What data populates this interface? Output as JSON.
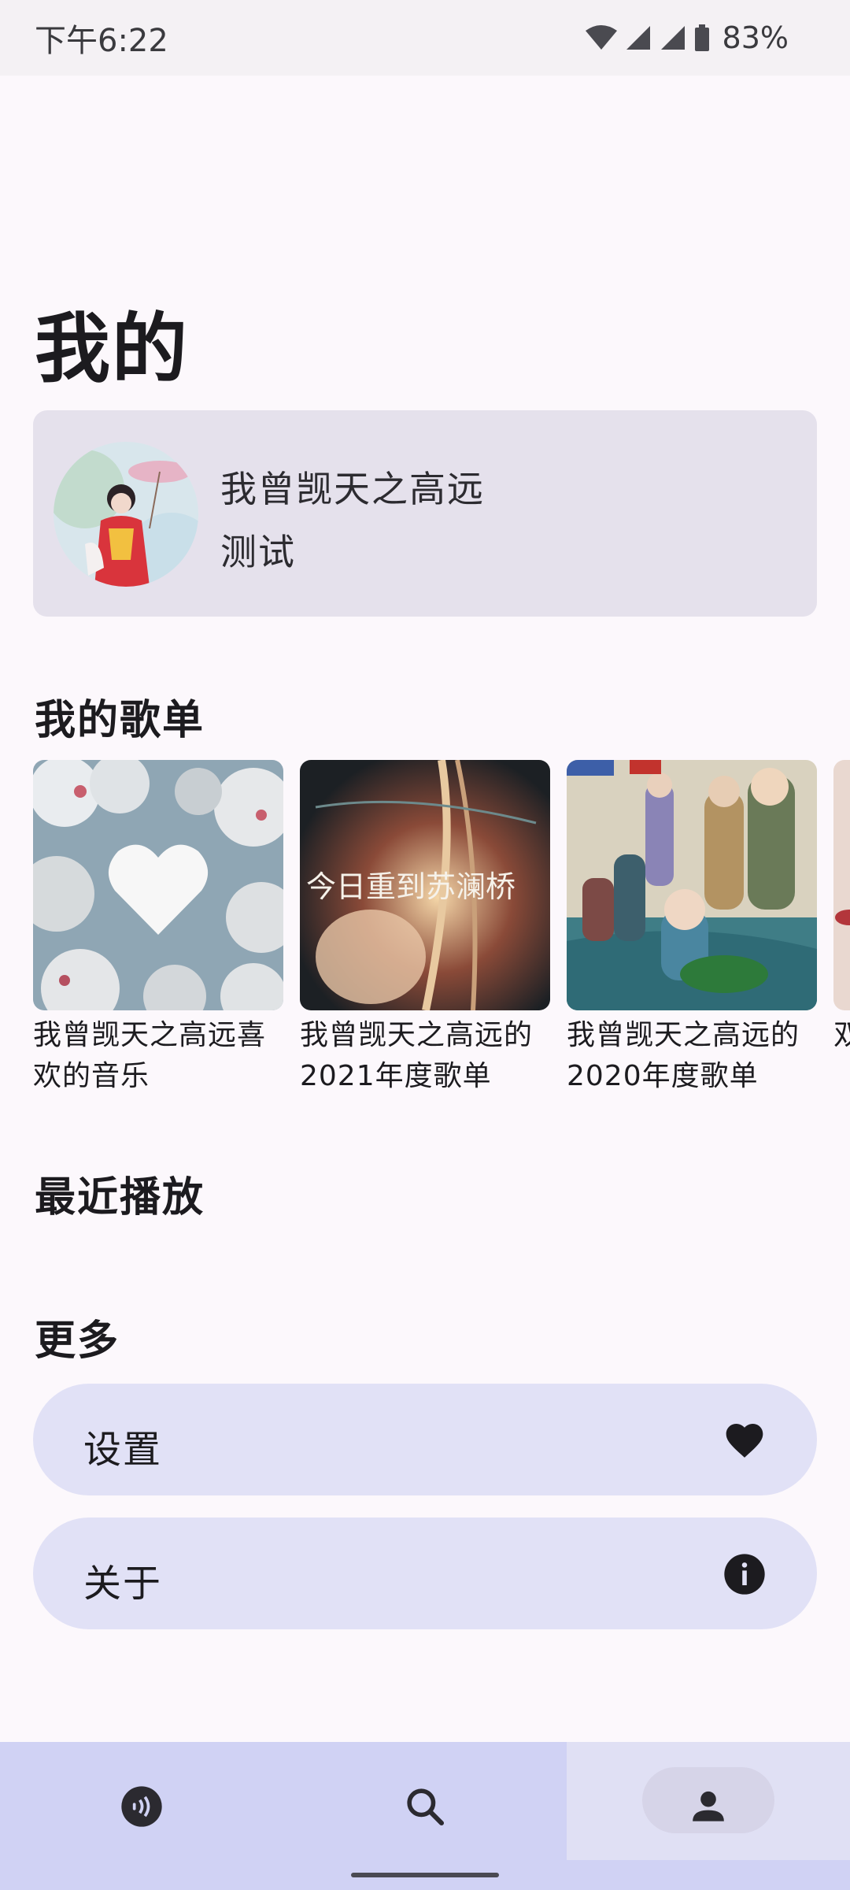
{
  "status_bar": {
    "time": "下午6:22",
    "battery": "83%"
  },
  "page_title": "我的",
  "profile": {
    "name": "我曾觊天之高远",
    "subtitle": "测试"
  },
  "sections": {
    "playlists_title": "我的歌单",
    "recent_title": "最近播放",
    "more_title": "更多"
  },
  "playlists": [
    {
      "name": "我曾觊天之高远喜欢的音乐"
    },
    {
      "name": "我曾觊天之高远的2021年度歌单",
      "cover_text": "今日重到苏澜桥"
    },
    {
      "name": "我曾觊天之高远的2020年度歌单"
    },
    {
      "name": "双笙"
    }
  ],
  "menu": {
    "settings_label": "设置",
    "settings_icon": "heart-icon",
    "about_label": "关于",
    "about_icon": "info-icon"
  },
  "bottom_nav": [
    {
      "icon": "podcast-icon",
      "selected": false
    },
    {
      "icon": "search-icon",
      "selected": false
    },
    {
      "icon": "person-icon",
      "selected": true
    }
  ],
  "colors": {
    "background": "#fcf8fc",
    "card": "#e5e1ec",
    "menu_item": "#e1e1f6",
    "nav_bar": "#d0d2f4"
  }
}
